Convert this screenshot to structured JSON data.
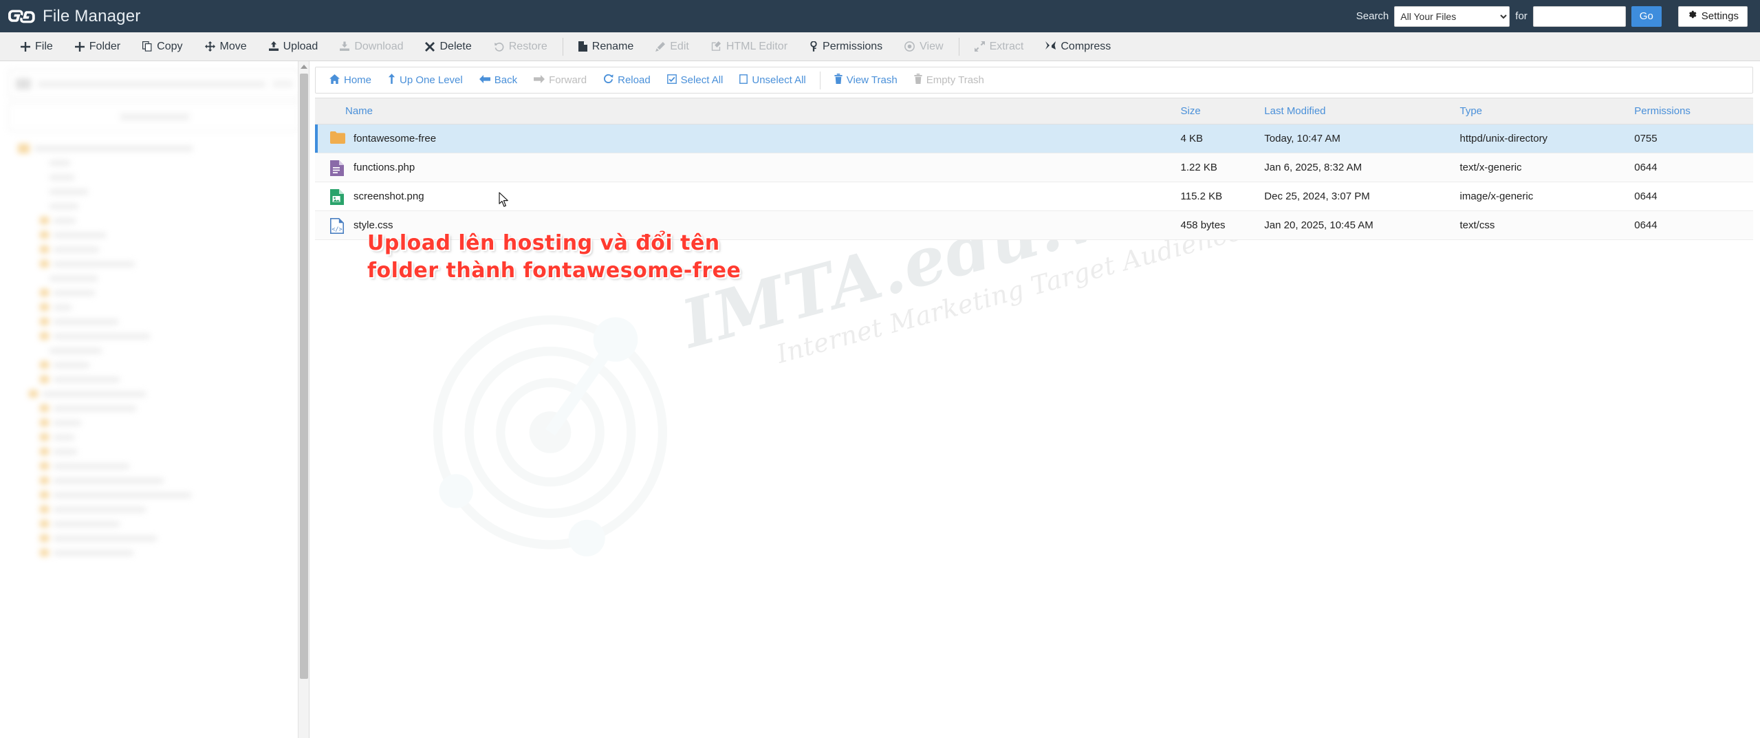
{
  "header": {
    "logo_icon": "cpanel-logo-icon",
    "app_title": "File Manager",
    "search_label": "Search",
    "search_scope_selected": "All Your Files",
    "search_scope_options": [
      "All Your Files"
    ],
    "for_label": "for",
    "search_value": "",
    "search_placeholder": "",
    "go_label": "Go",
    "settings_label": "Settings",
    "settings_icon": "gear-icon",
    "bg_color": "#2b3e50",
    "accent_color": "#3e8ddd"
  },
  "toolbar": {
    "items": [
      {
        "label": "File",
        "icon": "plus-icon",
        "disabled": false
      },
      {
        "label": "Folder",
        "icon": "plus-icon",
        "disabled": false
      },
      {
        "label": "Copy",
        "icon": "copy-icon",
        "disabled": false
      },
      {
        "label": "Move",
        "icon": "move-arrows-icon",
        "disabled": false
      },
      {
        "label": "Upload",
        "icon": "upload-icon",
        "disabled": false
      },
      {
        "label": "Download",
        "icon": "download-icon",
        "disabled": true
      },
      {
        "label": "Delete",
        "icon": "x-mark-icon",
        "disabled": false
      },
      {
        "label": "Restore",
        "icon": "undo-icon",
        "disabled": true
      },
      {
        "label": "Rename",
        "icon": "file-text-icon",
        "disabled": false
      },
      {
        "label": "Edit",
        "icon": "pencil-icon",
        "disabled": true
      },
      {
        "label": "HTML Editor",
        "icon": "edit-square-icon",
        "disabled": true
      },
      {
        "label": "Permissions",
        "icon": "key-icon",
        "disabled": false
      },
      {
        "label": "View",
        "icon": "eye-icon",
        "disabled": true
      },
      {
        "label": "Extract",
        "icon": "expand-icon",
        "disabled": true
      },
      {
        "label": "Compress",
        "icon": "compress-icon",
        "disabled": false
      }
    ]
  },
  "navbar": {
    "items": [
      {
        "label": "Home",
        "icon": "home-icon",
        "disabled": false
      },
      {
        "label": "Up One Level",
        "icon": "arrow-up-icon",
        "disabled": false
      },
      {
        "label": "Back",
        "icon": "arrow-left-icon",
        "disabled": false
      },
      {
        "label": "Forward",
        "icon": "arrow-right-icon",
        "disabled": true
      },
      {
        "label": "Reload",
        "icon": "refresh-icon",
        "disabled": false
      },
      {
        "label": "Select All",
        "icon": "checkbox-checked-icon",
        "disabled": false
      },
      {
        "label": "Unselect All",
        "icon": "checkbox-empty-icon",
        "disabled": false
      },
      {
        "label": "View Trash",
        "icon": "trash-icon",
        "disabled": false
      },
      {
        "label": "Empty Trash",
        "icon": "trash-icon",
        "disabled": true
      }
    ]
  },
  "file_table": {
    "columns": [
      "Name",
      "Size",
      "Last Modified",
      "Type",
      "Permissions"
    ],
    "rows": [
      {
        "name": "fontawesome-free",
        "size": "4 KB",
        "modified": "Today, 10:47 AM",
        "type": "httpd/unix-directory",
        "permissions": "0755",
        "icon": "folder-icon",
        "icon_color": "#f0ad4e",
        "selected": true
      },
      {
        "name": "functions.php",
        "size": "1.22 KB",
        "modified": "Jan 6, 2025, 8:32 AM",
        "type": "text/x-generic",
        "permissions": "0644",
        "icon": "php-file-icon",
        "icon_color": "#8a6aa8",
        "selected": false
      },
      {
        "name": "screenshot.png",
        "size": "115.2 KB",
        "modified": "Dec 25, 2024, 3:07 PM",
        "type": "image/x-generic",
        "permissions": "0644",
        "icon": "image-file-icon",
        "icon_color": "#2aa36b",
        "selected": false
      },
      {
        "name": "style.css",
        "size": "458 bytes",
        "modified": "Jan 20, 2025, 10:45 AM",
        "type": "text/css",
        "permissions": "0644",
        "icon": "css-file-icon",
        "icon_color": "#4a7fc1",
        "selected": false
      }
    ]
  },
  "annotation": {
    "line1": "Upload lên hosting và đổi tên",
    "line2": "folder thành fontawesome-free",
    "color": "#ff3b30"
  },
  "watermark": {
    "main": "IMTA.edu.vn",
    "sub": "Internet Marketing Target Audience",
    "color": "#e9eced"
  },
  "sidebar": {
    "note": "blurred-directory-tree"
  }
}
